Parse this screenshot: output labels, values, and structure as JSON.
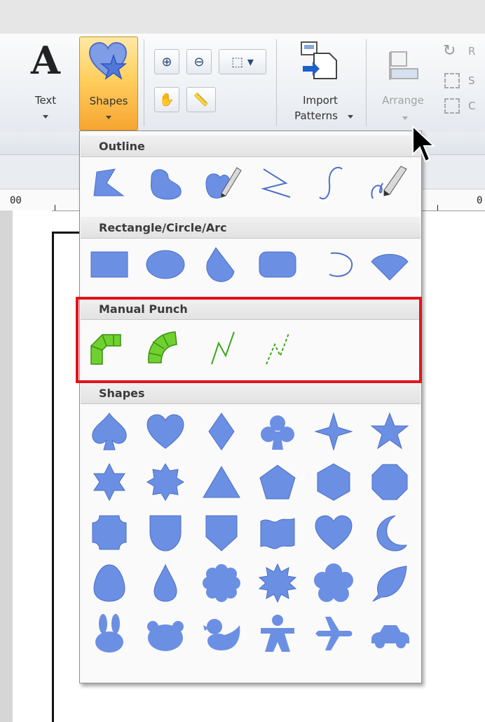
{
  "ribbon": {
    "text_label": "Text",
    "shapes_label": "Shapes",
    "import_label_1": "Import",
    "import_label_2": "Patterns",
    "arrange_label": "Arrange",
    "clip_right_1": "R",
    "clip_right_2": "S",
    "clip_right_3": "C"
  },
  "ruler": {
    "left_number": "00",
    "right_number": "0"
  },
  "menu": {
    "sections": [
      {
        "title": "Outline",
        "icons": [
          "polygon-outline-icon",
          "curve-outline-icon",
          "freehand-outline-icon",
          "polyline-icon",
          "curve-line-icon",
          "freehand-line-icon"
        ]
      },
      {
        "title": "Rectangle/Circle/Arc",
        "icons": [
          "rectangle-icon",
          "ellipse-icon",
          "fan-shape-icon",
          "rounded-rectangle-icon",
          "arc-icon",
          "chord-icon"
        ]
      },
      {
        "title": "Manual Punch",
        "icons": [
          "manual-punch-straight-icon",
          "manual-punch-curve-icon",
          "manual-punch-line-icon",
          "manual-punch-dashed-line-icon"
        ]
      },
      {
        "title": "Shapes",
        "icons": [
          "spade",
          "heart",
          "diamond",
          "club",
          "four-point-star",
          "star",
          "six-point-star",
          "eight-point-star",
          "triangle",
          "pentagon",
          "hexagon",
          "octagon",
          "notched-square",
          "shield-round",
          "shield-pointed",
          "banner",
          "heart-2",
          "crescent",
          "egg",
          "drop",
          "flower-8",
          "starburst",
          "flower-5",
          "leaf",
          "rabbit",
          "bear",
          "duck",
          "gingerbread-man",
          "airplane",
          "car"
        ]
      }
    ]
  },
  "colors": {
    "icon_blue": "#6b8fe3",
    "icon_blue_dark": "#4b6fc9",
    "punch_green": "#6fd12f",
    "highlight_red": "#e3121b",
    "shapes_btn_orange": "#ffcf5e"
  }
}
